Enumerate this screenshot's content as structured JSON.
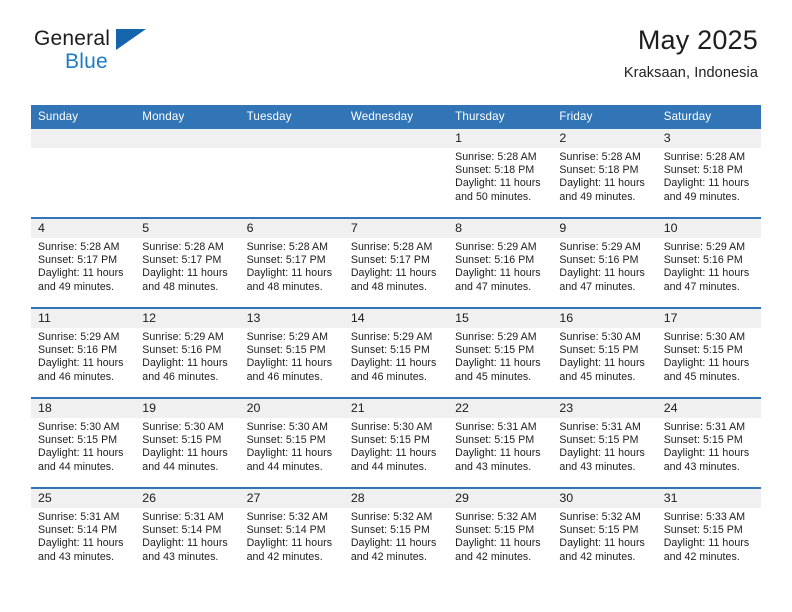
{
  "brand": {
    "name_top": "General",
    "name_bottom": "Blue",
    "accent_color": "#1565ad",
    "text_blue": "#1e7bc4"
  },
  "header": {
    "title": "May 2025",
    "subtitle": "Kraksaan, Indonesia"
  },
  "theme": {
    "header_bg": "#3175b6",
    "daynum_band": "#f0f0f0",
    "rule": "#3175b6"
  },
  "weekday_headers": [
    "Sunday",
    "Monday",
    "Tuesday",
    "Wednesday",
    "Thursday",
    "Friday",
    "Saturday"
  ],
  "weeks": [
    [
      {
        "day": "",
        "empty": true
      },
      {
        "day": "",
        "empty": true
      },
      {
        "day": "",
        "empty": true
      },
      {
        "day": "",
        "empty": true
      },
      {
        "day": "1",
        "sunrise": "Sunrise: 5:28 AM",
        "sunset": "Sunset: 5:18 PM",
        "daylight_1": "Daylight: 11 hours",
        "daylight_2": "and 50 minutes."
      },
      {
        "day": "2",
        "sunrise": "Sunrise: 5:28 AM",
        "sunset": "Sunset: 5:18 PM",
        "daylight_1": "Daylight: 11 hours",
        "daylight_2": "and 49 minutes."
      },
      {
        "day": "3",
        "sunrise": "Sunrise: 5:28 AM",
        "sunset": "Sunset: 5:18 PM",
        "daylight_1": "Daylight: 11 hours",
        "daylight_2": "and 49 minutes."
      }
    ],
    [
      {
        "day": "4",
        "sunrise": "Sunrise: 5:28 AM",
        "sunset": "Sunset: 5:17 PM",
        "daylight_1": "Daylight: 11 hours",
        "daylight_2": "and 49 minutes."
      },
      {
        "day": "5",
        "sunrise": "Sunrise: 5:28 AM",
        "sunset": "Sunset: 5:17 PM",
        "daylight_1": "Daylight: 11 hours",
        "daylight_2": "and 48 minutes."
      },
      {
        "day": "6",
        "sunrise": "Sunrise: 5:28 AM",
        "sunset": "Sunset: 5:17 PM",
        "daylight_1": "Daylight: 11 hours",
        "daylight_2": "and 48 minutes."
      },
      {
        "day": "7",
        "sunrise": "Sunrise: 5:28 AM",
        "sunset": "Sunset: 5:17 PM",
        "daylight_1": "Daylight: 11 hours",
        "daylight_2": "and 48 minutes."
      },
      {
        "day": "8",
        "sunrise": "Sunrise: 5:29 AM",
        "sunset": "Sunset: 5:16 PM",
        "daylight_1": "Daylight: 11 hours",
        "daylight_2": "and 47 minutes."
      },
      {
        "day": "9",
        "sunrise": "Sunrise: 5:29 AM",
        "sunset": "Sunset: 5:16 PM",
        "daylight_1": "Daylight: 11 hours",
        "daylight_2": "and 47 minutes."
      },
      {
        "day": "10",
        "sunrise": "Sunrise: 5:29 AM",
        "sunset": "Sunset: 5:16 PM",
        "daylight_1": "Daylight: 11 hours",
        "daylight_2": "and 47 minutes."
      }
    ],
    [
      {
        "day": "11",
        "sunrise": "Sunrise: 5:29 AM",
        "sunset": "Sunset: 5:16 PM",
        "daylight_1": "Daylight: 11 hours",
        "daylight_2": "and 46 minutes."
      },
      {
        "day": "12",
        "sunrise": "Sunrise: 5:29 AM",
        "sunset": "Sunset: 5:16 PM",
        "daylight_1": "Daylight: 11 hours",
        "daylight_2": "and 46 minutes."
      },
      {
        "day": "13",
        "sunrise": "Sunrise: 5:29 AM",
        "sunset": "Sunset: 5:15 PM",
        "daylight_1": "Daylight: 11 hours",
        "daylight_2": "and 46 minutes."
      },
      {
        "day": "14",
        "sunrise": "Sunrise: 5:29 AM",
        "sunset": "Sunset: 5:15 PM",
        "daylight_1": "Daylight: 11 hours",
        "daylight_2": "and 46 minutes."
      },
      {
        "day": "15",
        "sunrise": "Sunrise: 5:29 AM",
        "sunset": "Sunset: 5:15 PM",
        "daylight_1": "Daylight: 11 hours",
        "daylight_2": "and 45 minutes."
      },
      {
        "day": "16",
        "sunrise": "Sunrise: 5:30 AM",
        "sunset": "Sunset: 5:15 PM",
        "daylight_1": "Daylight: 11 hours",
        "daylight_2": "and 45 minutes."
      },
      {
        "day": "17",
        "sunrise": "Sunrise: 5:30 AM",
        "sunset": "Sunset: 5:15 PM",
        "daylight_1": "Daylight: 11 hours",
        "daylight_2": "and 45 minutes."
      }
    ],
    [
      {
        "day": "18",
        "sunrise": "Sunrise: 5:30 AM",
        "sunset": "Sunset: 5:15 PM",
        "daylight_1": "Daylight: 11 hours",
        "daylight_2": "and 44 minutes."
      },
      {
        "day": "19",
        "sunrise": "Sunrise: 5:30 AM",
        "sunset": "Sunset: 5:15 PM",
        "daylight_1": "Daylight: 11 hours",
        "daylight_2": "and 44 minutes."
      },
      {
        "day": "20",
        "sunrise": "Sunrise: 5:30 AM",
        "sunset": "Sunset: 5:15 PM",
        "daylight_1": "Daylight: 11 hours",
        "daylight_2": "and 44 minutes."
      },
      {
        "day": "21",
        "sunrise": "Sunrise: 5:30 AM",
        "sunset": "Sunset: 5:15 PM",
        "daylight_1": "Daylight: 11 hours",
        "daylight_2": "and 44 minutes."
      },
      {
        "day": "22",
        "sunrise": "Sunrise: 5:31 AM",
        "sunset": "Sunset: 5:15 PM",
        "daylight_1": "Daylight: 11 hours",
        "daylight_2": "and 43 minutes."
      },
      {
        "day": "23",
        "sunrise": "Sunrise: 5:31 AM",
        "sunset": "Sunset: 5:15 PM",
        "daylight_1": "Daylight: 11 hours",
        "daylight_2": "and 43 minutes."
      },
      {
        "day": "24",
        "sunrise": "Sunrise: 5:31 AM",
        "sunset": "Sunset: 5:15 PM",
        "daylight_1": "Daylight: 11 hours",
        "daylight_2": "and 43 minutes."
      }
    ],
    [
      {
        "day": "25",
        "sunrise": "Sunrise: 5:31 AM",
        "sunset": "Sunset: 5:14 PM",
        "daylight_1": "Daylight: 11 hours",
        "daylight_2": "and 43 minutes."
      },
      {
        "day": "26",
        "sunrise": "Sunrise: 5:31 AM",
        "sunset": "Sunset: 5:14 PM",
        "daylight_1": "Daylight: 11 hours",
        "daylight_2": "and 43 minutes."
      },
      {
        "day": "27",
        "sunrise": "Sunrise: 5:32 AM",
        "sunset": "Sunset: 5:14 PM",
        "daylight_1": "Daylight: 11 hours",
        "daylight_2": "and 42 minutes."
      },
      {
        "day": "28",
        "sunrise": "Sunrise: 5:32 AM",
        "sunset": "Sunset: 5:15 PM",
        "daylight_1": "Daylight: 11 hours",
        "daylight_2": "and 42 minutes."
      },
      {
        "day": "29",
        "sunrise": "Sunrise: 5:32 AM",
        "sunset": "Sunset: 5:15 PM",
        "daylight_1": "Daylight: 11 hours",
        "daylight_2": "and 42 minutes."
      },
      {
        "day": "30",
        "sunrise": "Sunrise: 5:32 AM",
        "sunset": "Sunset: 5:15 PM",
        "daylight_1": "Daylight: 11 hours",
        "daylight_2": "and 42 minutes."
      },
      {
        "day": "31",
        "sunrise": "Sunrise: 5:33 AM",
        "sunset": "Sunset: 5:15 PM",
        "daylight_1": "Daylight: 11 hours",
        "daylight_2": "and 42 minutes."
      }
    ]
  ]
}
